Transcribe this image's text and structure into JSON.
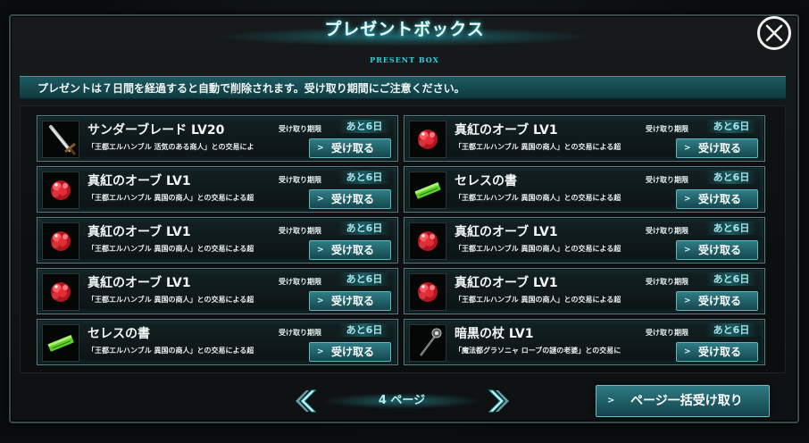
{
  "header": {
    "title": "プレゼントボックス",
    "subtitle": "PRESENT BOX"
  },
  "notice": "プレゼントは７日間を経過すると自動で削除されます。受け取り期間にご注意ください。",
  "close": {
    "icon": "close-icon"
  },
  "items": [
    {
      "name": "サンダーブレード LV20",
      "period_label": "受け取り期限",
      "remaining": "あと6日",
      "description": "「王都エルハンブル 活気のある商人」との交易によ",
      "button": "受け取る",
      "icon": "sword-icon"
    },
    {
      "name": "真紅のオーブ LV1",
      "period_label": "受け取り期限",
      "remaining": "あと6日",
      "description": "「王都エルハンブル 異国の商人」との交易による超",
      "button": "受け取る",
      "icon": "red-orb-icon"
    },
    {
      "name": "真紅のオーブ LV1",
      "period_label": "受け取り期限",
      "remaining": "あと6日",
      "description": "「王都エルハンブル 異国の商人」との交易による超",
      "button": "受け取る",
      "icon": "red-orb-icon"
    },
    {
      "name": "セレスの書",
      "period_label": "受け取り期限",
      "remaining": "あと6日",
      "description": "「王都エルハンブル 異国の商人」との交易による超",
      "button": "受け取る",
      "icon": "green-book-icon"
    },
    {
      "name": "真紅のオーブ LV1",
      "period_label": "受け取り期限",
      "remaining": "あと6日",
      "description": "「王都エルハンブル 異国の商人」との交易による超",
      "button": "受け取る",
      "icon": "red-orb-icon"
    },
    {
      "name": "真紅のオーブ LV1",
      "period_label": "受け取り期限",
      "remaining": "あと6日",
      "description": "「王都エルハンブル 異国の商人」との交易による超",
      "button": "受け取る",
      "icon": "red-orb-icon"
    },
    {
      "name": "真紅のオーブ LV1",
      "period_label": "受け取り期限",
      "remaining": "あと6日",
      "description": "「王都エルハンブル 異国の商人」との交易による超",
      "button": "受け取る",
      "icon": "red-orb-icon"
    },
    {
      "name": "真紅のオーブ LV1",
      "period_label": "受け取り期限",
      "remaining": "あと6日",
      "description": "「王都エルハンブル 異国の商人」との交易による超",
      "button": "受け取る",
      "icon": "red-orb-icon"
    },
    {
      "name": "セレスの書",
      "period_label": "受け取り期限",
      "remaining": "あと6日",
      "description": "「王都エルハンブル 異国の商人」との交易による超",
      "button": "受け取る",
      "icon": "green-book-icon"
    },
    {
      "name": "暗黒の杖 LV1",
      "period_label": "受け取り期限",
      "remaining": "あと6日",
      "description": "「魔法都グラソニャ ローブの謎の老婆」との交易に",
      "button": "受け取る",
      "icon": "dark-staff-icon"
    }
  ],
  "pager": {
    "label": "4 ページ",
    "prev_icon": "chevron-left-icon",
    "next_icon": "chevron-right-icon"
  },
  "bulk_button": "ページ一括受け取り",
  "colors": {
    "accent": "#2fd0de",
    "button": "#2f7d86",
    "remaining": "#9fe8ee",
    "orb": "#d8323c",
    "book": "#7ee04a"
  }
}
